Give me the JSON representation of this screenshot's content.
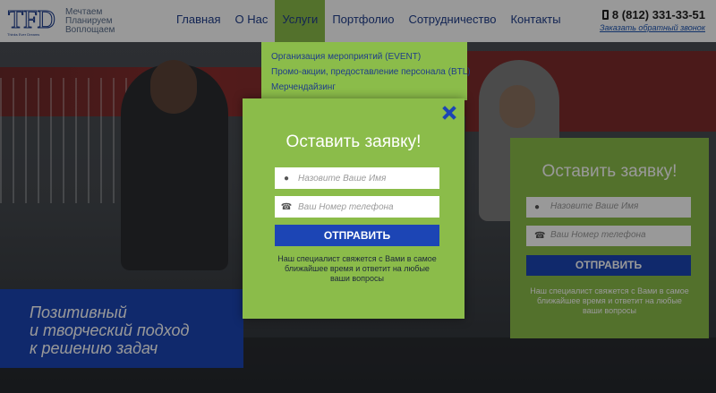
{
  "header": {
    "logo_text": "TFD",
    "logo_caption": "Thinks Ever Dreams",
    "slogan": [
      "Мечтаем",
      "Планируем",
      "Воплощаем"
    ],
    "nav": [
      {
        "label": "Главная",
        "active": false
      },
      {
        "label": "О Нас",
        "active": false
      },
      {
        "label": "Услуги",
        "active": true
      },
      {
        "label": "Портфолио",
        "active": false
      },
      {
        "label": "Сотрудничество",
        "active": false
      },
      {
        "label": "Контакты",
        "active": false
      }
    ],
    "phone": "8 (812) 331-33-51",
    "callback_link": "Заказать обратный звонок"
  },
  "dropdown": {
    "items": [
      "Организация мероприятий (EVENT)",
      "Промо-акции, предоставление персонала (BTL)",
      "Мерчендайзинг"
    ]
  },
  "hero": {
    "tagline": [
      "Позитивный",
      "и творческий подход",
      "к решению задач"
    ]
  },
  "side_form": {
    "title": "Оставить заявку!",
    "name_placeholder": "Назовите Ваше Имя",
    "phone_placeholder": "Ваш Номер телефона",
    "submit_label": "ОТПРАВИТЬ",
    "note": "Наш специалист свяжется с Вами в самое ближайшее время и ответит на любые ваши вопросы"
  },
  "modal": {
    "title": "Оставить заявку!",
    "name_placeholder": "Назовите Ваше Имя",
    "phone_placeholder": "Ваш Номер телефона",
    "submit_label": "ОТПРАВИТЬ",
    "note": "Наш специалист свяжется с Вами в самое ближайшее время и ответит на любые ваши вопросы"
  },
  "colors": {
    "brand_blue": "#1c45b5",
    "accent_green": "#8bbc4a",
    "nav_text": "#1f3d8a"
  },
  "icons": {
    "close": "close-icon",
    "user": "user-icon",
    "phone": "phone-icon"
  }
}
